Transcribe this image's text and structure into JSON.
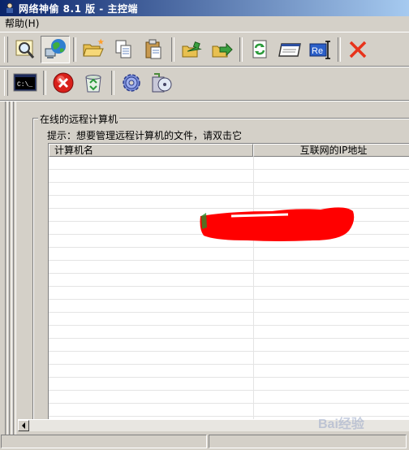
{
  "window": {
    "title": "网络神偷 8.1 版 - 主控端"
  },
  "menu": {
    "items": [
      {
        "label": "帮助(H)"
      }
    ]
  },
  "toolbar_row1": [
    {
      "icon": "magnifier-icon",
      "pressed": false
    },
    {
      "icon": "network-globe-icon",
      "pressed": true
    },
    {
      "icon": "open-folder-icon",
      "pressed": false
    },
    {
      "icon": "copy-icon",
      "pressed": false
    },
    {
      "icon": "paste-icon",
      "pressed": false
    },
    {
      "icon": "upload-icon",
      "pressed": false
    },
    {
      "icon": "download-icon",
      "pressed": false
    },
    {
      "icon": "refresh-icon",
      "pressed": false
    },
    {
      "icon": "window-icon",
      "pressed": false
    },
    {
      "icon": "rename-icon",
      "label": "Re",
      "pressed": false
    },
    {
      "icon": "delete-x-icon",
      "pressed": false
    }
  ],
  "toolbar_row2": [
    {
      "icon": "command-prompt-icon",
      "label": "C:\\_"
    },
    {
      "icon": "stop-icon"
    },
    {
      "icon": "recycle-bin-icon"
    },
    {
      "icon": "settings-gear-icon"
    },
    {
      "icon": "disk-cleanup-icon"
    }
  ],
  "online_panel": {
    "legend": "在线的远程计算机",
    "hint": "提示：想要管理远程计算机的文件，请双击它",
    "columns": [
      "计算机名",
      "互联网的IP地址"
    ]
  },
  "watermark": {
    "text": "Bai经验"
  },
  "colors": {
    "titlebar_start": "#0a246a",
    "titlebar_end": "#a6caf0",
    "redaction": "#ff0000",
    "delete_x": "#e8331b"
  }
}
